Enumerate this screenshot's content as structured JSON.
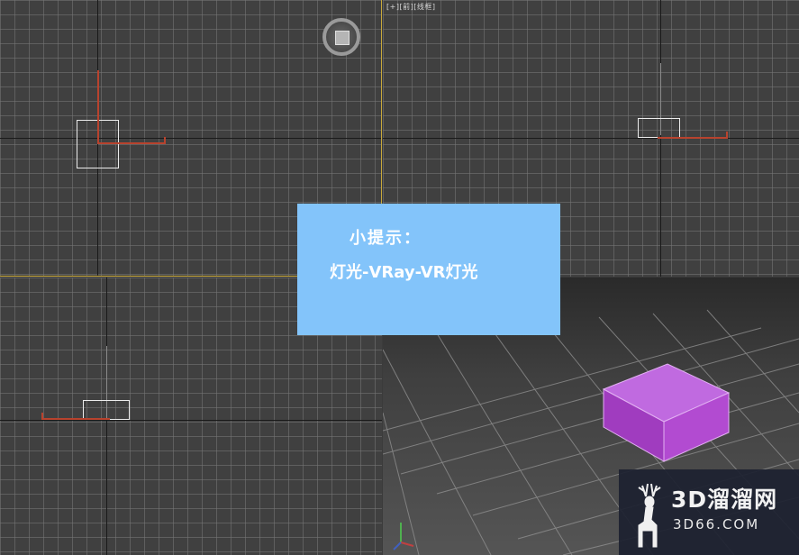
{
  "viewport_label": {
    "plus": "[+]",
    "view": "[前]",
    "mode": "[线框]"
  },
  "tip": {
    "title": "小提示：",
    "body": "灯光-VRay-VR灯光"
  },
  "watermark": {
    "title": "3D溜溜网",
    "subtitle": "3D66.COM"
  },
  "colors": {
    "viewport_bg": "#404040",
    "active_border": "#c9a93a",
    "tip_bg": "#83c4fa",
    "cube": "#b24bd1",
    "light_axis": "#b8432e",
    "watermark_bg": "#1c2130"
  },
  "icons": {
    "viewcube": "viewcube-icon",
    "deer": "deer-logo-icon",
    "axis_gizmo": "axis-gizmo-icon"
  }
}
